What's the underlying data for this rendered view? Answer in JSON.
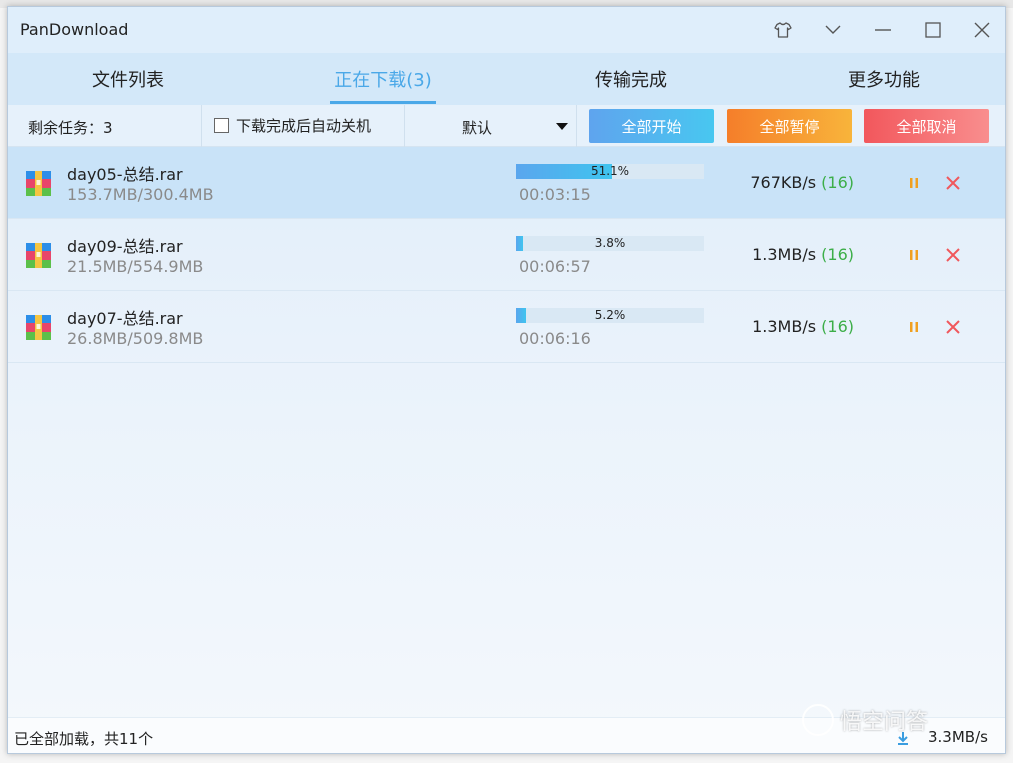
{
  "app": {
    "title": "PanDownload"
  },
  "tabs": [
    {
      "label": "文件列表",
      "active": false
    },
    {
      "label": "正在下载(3)",
      "active": true
    },
    {
      "label": "传输完成",
      "active": false
    },
    {
      "label": "更多功能",
      "active": false
    }
  ],
  "toolbar": {
    "remaining": "剩余任务：3",
    "auto_shutdown_label": "下载完成后自动关机",
    "auto_shutdown_checked": false,
    "sort_value": "默认",
    "start_all": "全部开始",
    "pause_all": "全部暂停",
    "cancel_all": "全部取消"
  },
  "downloads": [
    {
      "name": "day05-总结.rar",
      "size": "153.7MB/300.4MB",
      "progress": 0.511,
      "progress_text": "51.1%",
      "eta": "00:03:15",
      "speed": "767KB/s",
      "threads": "(16)",
      "selected": true
    },
    {
      "name": "day09-总结.rar",
      "size": "21.5MB/554.9MB",
      "progress": 0.038,
      "progress_text": "3.8%",
      "eta": "00:06:57",
      "speed": "1.3MB/s",
      "threads": "(16)",
      "selected": false
    },
    {
      "name": "day07-总结.rar",
      "size": "26.8MB/509.8MB",
      "progress": 0.052,
      "progress_text": "5.2%",
      "eta": "00:06:16",
      "speed": "1.3MB/s",
      "threads": "(16)",
      "selected": false
    }
  ],
  "status": {
    "text": "已全部加载，共11个",
    "total_speed": "3.3MB/s"
  },
  "watermark": "悟空问答",
  "colors": {
    "accent": "#4aa8e8",
    "threads": "#3cae48",
    "pause_icon": "#f0a020",
    "close_icon": "#f0585c"
  },
  "icons": {
    "skin": "shirt-icon",
    "menu": "chevron-down-icon",
    "minimize": "minimize-icon",
    "maximize": "maximize-icon",
    "close": "close-icon",
    "file": "rar-archive-icon",
    "pause": "pause-icon",
    "remove": "delete-x-icon",
    "download": "download-arrow-icon"
  }
}
